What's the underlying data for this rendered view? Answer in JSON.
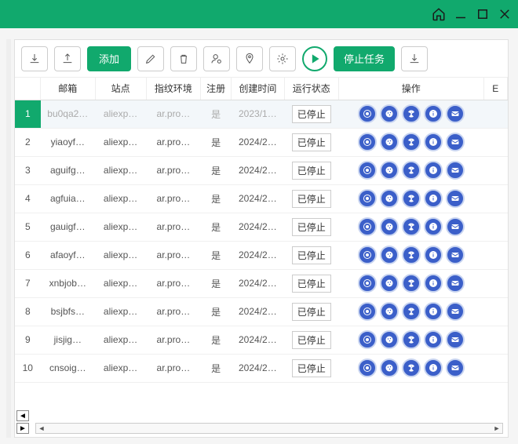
{
  "toolbar": {
    "add": "添加",
    "stop": "停止任务"
  },
  "cols": {
    "email": "邮箱",
    "site": "站点",
    "fp": "指纹环境",
    "reg": "注册",
    "created": "创建时间",
    "status": "运行状态",
    "ops": "操作",
    "extra": "E"
  },
  "status_label": "已停止",
  "rows": [
    {
      "n": 1,
      "email": "bu0qa2…",
      "site": "aliexp…",
      "fp": "ar.pro…",
      "reg": "是",
      "created": "2023/1…",
      "selected": true
    },
    {
      "n": 2,
      "email": "yiaoyf…",
      "site": "aliexp…",
      "fp": "ar.pro…",
      "reg": "是",
      "created": "2024/2…",
      "selected": false
    },
    {
      "n": 3,
      "email": "aguifg…",
      "site": "aliexp…",
      "fp": "ar.pro…",
      "reg": "是",
      "created": "2024/2…",
      "selected": false
    },
    {
      "n": 4,
      "email": "agfuia…",
      "site": "aliexp…",
      "fp": "ar.pro…",
      "reg": "是",
      "created": "2024/2…",
      "selected": false
    },
    {
      "n": 5,
      "email": "gauigf…",
      "site": "aliexp…",
      "fp": "ar.pro…",
      "reg": "是",
      "created": "2024/2…",
      "selected": false
    },
    {
      "n": 6,
      "email": "afaoyf…",
      "site": "aliexp…",
      "fp": "ar.pro…",
      "reg": "是",
      "created": "2024/2…",
      "selected": false
    },
    {
      "n": 7,
      "email": "xnbjob…",
      "site": "aliexp…",
      "fp": "ar.pro…",
      "reg": "是",
      "created": "2024/2…",
      "selected": false
    },
    {
      "n": 8,
      "email": "bsjbfs…",
      "site": "aliexp…",
      "fp": "ar.pro…",
      "reg": "是",
      "created": "2024/2…",
      "selected": false
    },
    {
      "n": 9,
      "email": "jisjig…",
      "site": "aliexp…",
      "fp": "ar.pro…",
      "reg": "是",
      "created": "2024/2…",
      "selected": false
    },
    {
      "n": 10,
      "email": "cnsoig…",
      "site": "aliexp…",
      "fp": "ar.pro…",
      "reg": "是",
      "created": "2024/2…",
      "selected": false
    }
  ],
  "op_icons": [
    "chrome-icon",
    "cookie-icon",
    "radiation-icon",
    "info-icon",
    "mail-icon"
  ]
}
